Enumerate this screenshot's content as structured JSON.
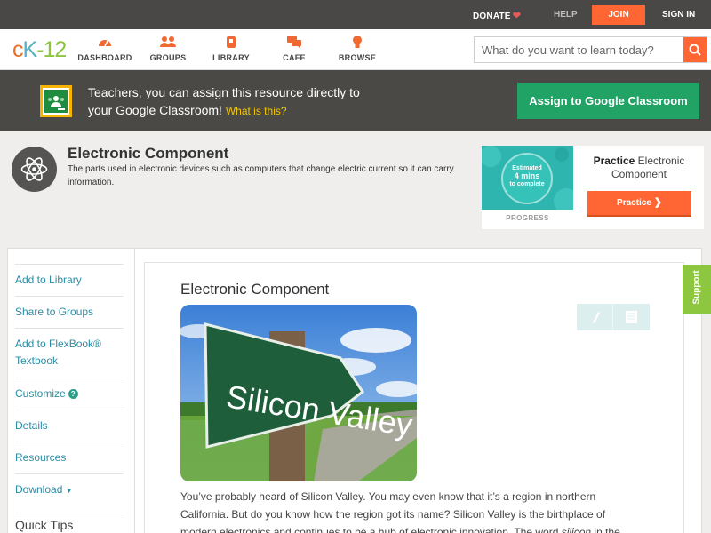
{
  "topbar": {
    "donate": "DONATE",
    "help": "HELP",
    "join": "JOIN",
    "signin": "SIGN IN"
  },
  "nav": {
    "logo_c": "c",
    "logo_k": "K",
    "logo_n": "-12",
    "items": [
      {
        "label": "DASHBOARD"
      },
      {
        "label": "GROUPS"
      },
      {
        "label": "LIBRARY"
      },
      {
        "label": "CAFE"
      },
      {
        "label": "BROWSE"
      }
    ],
    "search_placeholder": "What do you want to learn today?"
  },
  "classroom": {
    "line1": "Teachers, you can assign this resource directly to",
    "line2": "your Google Classroom!",
    "what": "What is this?",
    "button": "Assign to Google Classroom"
  },
  "concept": {
    "title": "Electronic Component",
    "description": "The parts used in electronic devices such as computers that change electric current so it can carry information."
  },
  "practice": {
    "estimated": "Estimated",
    "mins": "4 mins",
    "to_complete": "to complete",
    "progress": "PROGRESS",
    "title_bold": "Practice",
    "title_rest": "Electronic Component",
    "button": "Practice"
  },
  "sidebar": {
    "items": [
      {
        "label": "Add to Library"
      },
      {
        "label": "Share to Groups"
      },
      {
        "label": "Add to FlexBook® Textbook"
      },
      {
        "label": "Customize"
      },
      {
        "label": "Details"
      },
      {
        "label": "Resources"
      },
      {
        "label": "Download"
      }
    ],
    "quick_tips": "Quick Tips"
  },
  "article": {
    "title": "Electronic Component",
    "sign_text": "Silicon Valley",
    "para_a": "You’ve probably heard of Silicon Valley. You may even know that it’s a region in northern California. But do you know how the region got its name? Silicon Valley is the birthplace of modern electronics and continues to be a hub of electronic innovation. The word ",
    "para_em": "silicon",
    "para_b": " in the"
  },
  "support": "Support",
  "colors": {
    "accent": "#ff6633",
    "green": "#21a366",
    "link": "#2d8ca3"
  }
}
